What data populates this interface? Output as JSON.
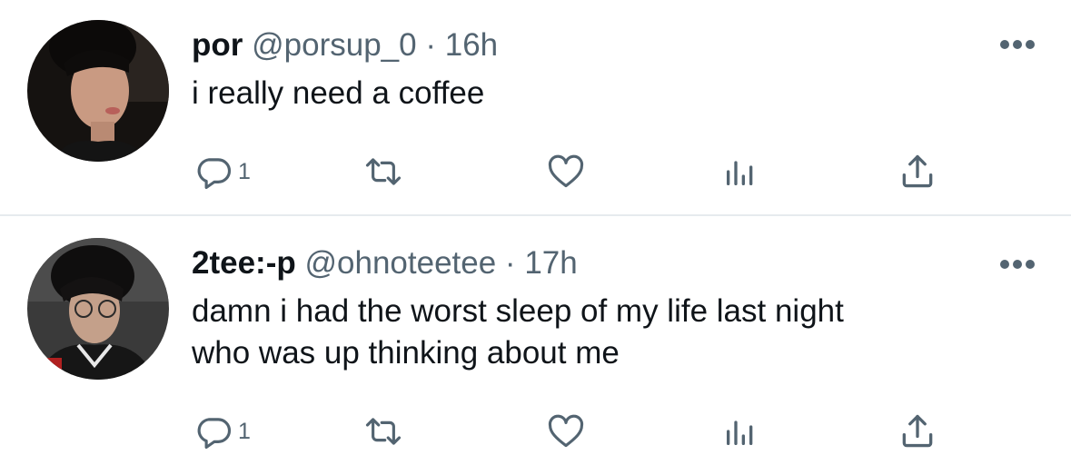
{
  "tweets": [
    {
      "display_name": "por",
      "handle": "@porsup_0",
      "separator": "·",
      "time": "16h",
      "text_lines": [
        "i really need a coffee"
      ],
      "reply_count": "1",
      "avatar_icon": "user-avatar-photo"
    },
    {
      "display_name": "2tee:-p",
      "handle": "@ohnoteetee",
      "separator": "·",
      "time": "17h",
      "text_lines": [
        "damn i had the worst sleep of my life last night",
        "who was up thinking about me"
      ],
      "reply_count": "1",
      "avatar_icon": "user-avatar-photo"
    }
  ],
  "icons": {
    "reply": "reply-icon",
    "retweet": "retweet-icon",
    "like": "heart-icon",
    "views": "analytics-icon",
    "share": "share-icon",
    "more": "more-options-icon"
  },
  "colors": {
    "text": "#0f1419",
    "secondary": "#536471",
    "divider": "#e6ebee"
  }
}
